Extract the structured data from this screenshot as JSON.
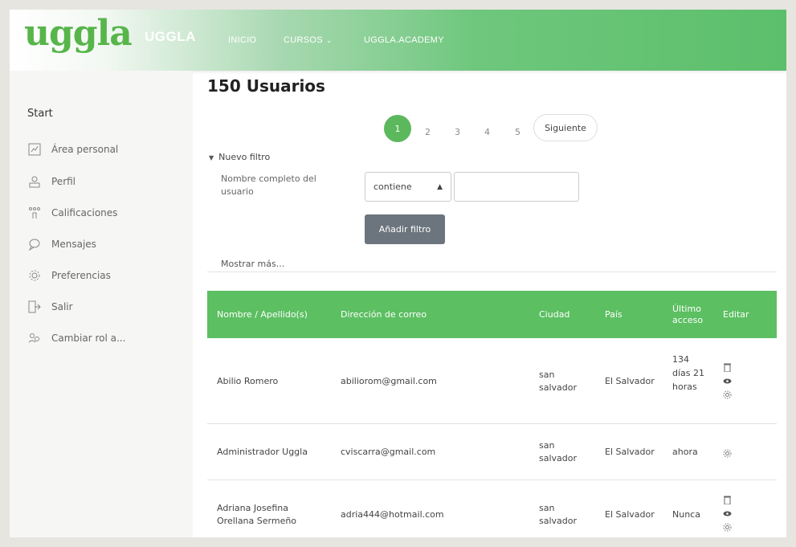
{
  "header": {
    "logo_text": "uggla",
    "brand": "UGGLA",
    "nav": {
      "inicio": "INICIO",
      "cursos": "CURSOS",
      "academy": "UGGLA.ACADEMY"
    }
  },
  "sidebar": {
    "start": "Start",
    "items": [
      {
        "label": "Área personal",
        "icon": "dashboard-icon"
      },
      {
        "label": "Perfil",
        "icon": "profile-icon"
      },
      {
        "label": "Calificaciones",
        "icon": "grades-icon"
      },
      {
        "label": "Mensajes",
        "icon": "messages-icon"
      },
      {
        "label": "Preferencias",
        "icon": "gear-icon"
      },
      {
        "label": "Salir",
        "icon": "logout-icon"
      },
      {
        "label": "Cambiar rol a...",
        "icon": "switch-role-icon"
      }
    ]
  },
  "main": {
    "title": "150 Usuarios",
    "pagination": {
      "active": "1",
      "pages": [
        "2",
        "3",
        "4",
        "5"
      ],
      "next": "Siguiente"
    },
    "filter": {
      "toggle": "Nuevo filtro",
      "field_label": "Nombre completo del usuario",
      "operator": "contiene",
      "value": "",
      "add_button": "Añadir filtro",
      "show_more": "Mostrar más..."
    },
    "table": {
      "headers": {
        "name": "Nombre / Apellido(s)",
        "email": "Dirección de correo",
        "city": "Ciudad",
        "country": "País",
        "last_access": "Último acceso",
        "edit": "Editar"
      },
      "rows": [
        {
          "name": "Abilio Romero",
          "email": "abiliorom@gmail.com",
          "city": "san salvador",
          "country": "El Salvador",
          "last_access": "134 días 21 horas",
          "actions": [
            "delete-icon",
            "view-icon",
            "settings-icon"
          ]
        },
        {
          "name": "Administrador Uggla",
          "email": "cviscarra@gmail.com",
          "city": "san salvador",
          "country": "El Salvador",
          "last_access": "ahora",
          "actions": [
            "settings-icon"
          ]
        },
        {
          "name": "Adriana Josefina Orellana Sermeño",
          "email": "adria444@hotmail.com",
          "city": "san salvador",
          "country": "El Salvador",
          "last_access": "Nunca",
          "actions": [
            "delete-icon",
            "view-icon",
            "settings-icon"
          ]
        }
      ]
    }
  },
  "colors": {
    "accent": "#5cbf62",
    "logo": "#57b54a",
    "button": "#6c757d"
  }
}
